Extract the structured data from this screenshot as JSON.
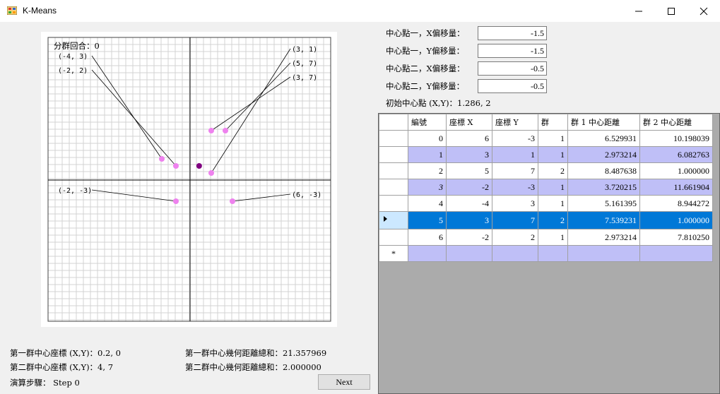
{
  "window": {
    "title": "K-Means"
  },
  "plot": {
    "round_label": "分群回合：0",
    "points": [
      {
        "x": 6,
        "y": -3,
        "label": "(6, -3)"
      },
      {
        "x": 3,
        "y": 1,
        "label": "(3, 1)"
      },
      {
        "x": 5,
        "y": 7,
        "label": "(5, 7)"
      },
      {
        "x": -2,
        "y": -3,
        "label": "(-2, -3)"
      },
      {
        "x": -4,
        "y": 3,
        "label": "(-4, 3)"
      },
      {
        "x": 3,
        "y": 7,
        "label": "(3, 7)"
      },
      {
        "x": -2,
        "y": 2,
        "label": "(-2, 2)"
      }
    ],
    "center": {
      "x": 1.286,
      "y": 2
    }
  },
  "offsets": [
    {
      "label": "中心點一，X偏移量：",
      "value": "-1.5"
    },
    {
      "label": "中心點一，Y偏移量：",
      "value": "-1.5"
    },
    {
      "label": "中心點二，X偏移量：",
      "value": "-0.5"
    },
    {
      "label": "中心點二，Y偏移量：",
      "value": "-0.5"
    }
  ],
  "initial_center": "初始中心點 (X,Y)：1.286, 2",
  "table": {
    "headers": [
      "編號",
      "座標 X",
      "座標 Y",
      "群",
      "群 1 中心距離",
      "群 2 中心距離"
    ],
    "rows": [
      [
        "0",
        "6",
        "-3",
        "1",
        "6.529931",
        "10.198039"
      ],
      [
        "1",
        "3",
        "1",
        "1",
        "2.973214",
        "6.082763"
      ],
      [
        "2",
        "5",
        "7",
        "2",
        "8.487638",
        "1.000000"
      ],
      [
        "3",
        "-2",
        "-3",
        "1",
        "3.720215",
        "11.661904"
      ],
      [
        "4",
        "-4",
        "3",
        "1",
        "5.161395",
        "8.944272"
      ],
      [
        "5",
        "3",
        "7",
        "2",
        "7.539231",
        "1.000000"
      ],
      [
        "6",
        "-2",
        "2",
        "1",
        "2.973214",
        "7.810250"
      ]
    ],
    "new_row_marker": "*"
  },
  "stats": {
    "c1_coord": "第一群中心座標 (X,Y)：0.2, 0",
    "c2_coord": "第二群中心座標 (X,Y)：4, 7",
    "step": "演算步驟： Step 0",
    "c1_sum": "第一群中心幾何距離總和：21.357969",
    "c2_sum": "第二群中心幾何距離總和：2.000000"
  },
  "next_button": "Next"
}
